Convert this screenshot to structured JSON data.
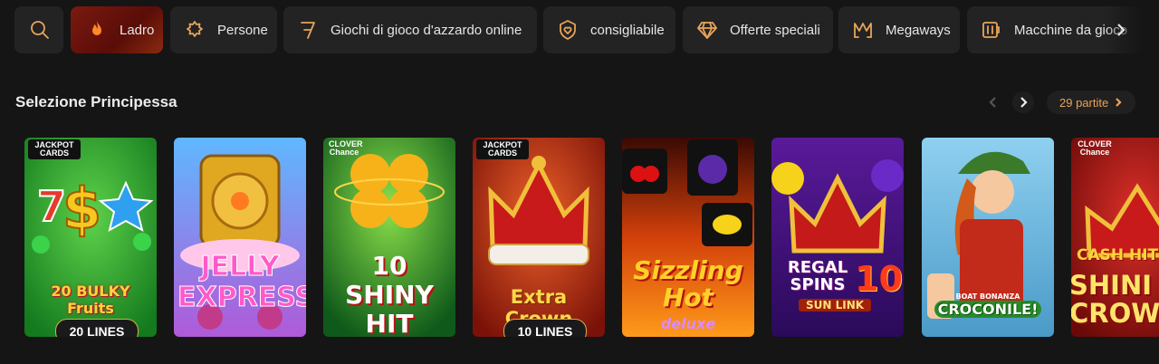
{
  "categories": [
    {
      "label": "",
      "icon": "search-icon",
      "active": false
    },
    {
      "label": "Ladro",
      "icon": "flame-icon",
      "active": true
    },
    {
      "label": "Persone",
      "icon": "sparkle-badge-icon",
      "active": false
    },
    {
      "label": "Giochi di gioco d'azzardo online",
      "icon": "seven-icon",
      "active": false
    },
    {
      "label": "consigliabile",
      "icon": "heart-shield-icon",
      "active": false
    },
    {
      "label": "Offerte speciali",
      "icon": "diamond-icon",
      "active": false
    },
    {
      "label": "Megaways",
      "icon": "megaways-icon",
      "active": false
    },
    {
      "label": "Macchine da gioco",
      "icon": "slot-machine-icon",
      "active": false
    }
  ],
  "section": {
    "title": "Selezione Principessa",
    "count_label": "29 partite"
  },
  "games": [
    {
      "title": "20 BULKY Fruits",
      "badge": "JACKPOT CARDS",
      "pill": "20 LINES"
    },
    {
      "title": "JELLY EXPRESS",
      "badge": "",
      "pill": ""
    },
    {
      "title_line1": "10",
      "title_line2": "SHINY",
      "title_line3": "HIT",
      "badge": "CLOVER Chance",
      "pill": ""
    },
    {
      "title": "Extra Crown",
      "badge": "JACKPOT CARDS",
      "pill": "10 LINES"
    },
    {
      "title": "Sizzling Hot",
      "subtitle": "deluxe",
      "badge": "",
      "pill": ""
    },
    {
      "title_line1": "REGAL",
      "title_line2": "SPINS",
      "number": "10",
      "subtitle": "SUN LINK",
      "badge": "",
      "pill": ""
    },
    {
      "title": "CROCONILE!",
      "subtitle": "BOAT BONANZA",
      "badge": "",
      "pill": ""
    },
    {
      "title_line1": "CASH HIT",
      "title_line2": "SHINI",
      "title_line3": "CROW",
      "badge": "CLOVER Chance",
      "pill": ""
    }
  ],
  "colors": {
    "background": "#151515",
    "accent": "#e8a45a",
    "chip": "#232323",
    "active_chip": "#7a1a10"
  }
}
